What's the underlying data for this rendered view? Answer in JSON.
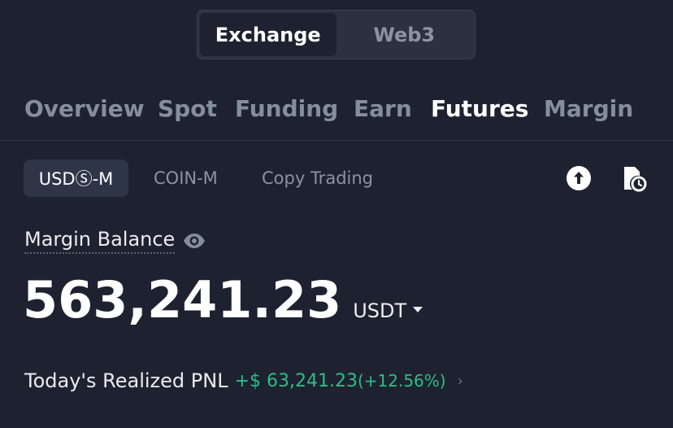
{
  "segment": {
    "options": [
      "Exchange",
      "Web3"
    ],
    "selected": "Exchange"
  },
  "tabs": {
    "items": [
      "Overview",
      "Spot",
      "Funding",
      "Earn",
      "Futures",
      "Margin"
    ],
    "selected": "Futures"
  },
  "subtabs": {
    "items": [
      "USDⓈ-M",
      "COIN-M",
      "Copy Trading"
    ],
    "selected": "USDⓈ-M"
  },
  "actions": {
    "transfer_icon": "arrow-up-circle-icon",
    "history_icon": "document-clock-icon"
  },
  "balance": {
    "label": "Margin Balance",
    "eye_icon": "eye-icon",
    "amount": "563,241.23",
    "currency": "USDT"
  },
  "pnl": {
    "label": "Today's Realized PNL",
    "value": "+$ 63,241.23",
    "percent": "(+12.56%)",
    "chevron": "›"
  },
  "colors": {
    "background": "#1e2230",
    "positive": "#2ebd85",
    "text_primary": "#ffffff",
    "text_secondary": "#848e9c"
  }
}
